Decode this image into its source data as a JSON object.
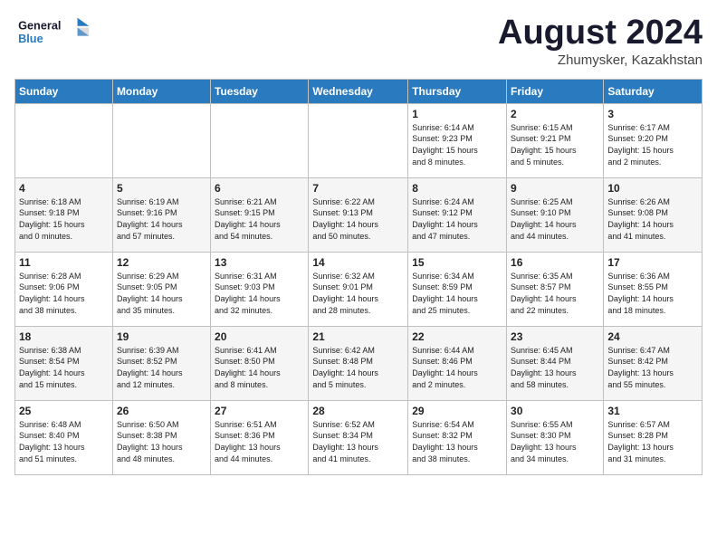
{
  "header": {
    "logo_general": "General",
    "logo_blue": "Blue",
    "month": "August 2024",
    "location": "Zhumysker, Kazakhstan"
  },
  "weekdays": [
    "Sunday",
    "Monday",
    "Tuesday",
    "Wednesday",
    "Thursday",
    "Friday",
    "Saturday"
  ],
  "weeks": [
    [
      {
        "day": "",
        "info": ""
      },
      {
        "day": "",
        "info": ""
      },
      {
        "day": "",
        "info": ""
      },
      {
        "day": "",
        "info": ""
      },
      {
        "day": "1",
        "info": "Sunrise: 6:14 AM\nSunset: 9:23 PM\nDaylight: 15 hours\nand 8 minutes."
      },
      {
        "day": "2",
        "info": "Sunrise: 6:15 AM\nSunset: 9:21 PM\nDaylight: 15 hours\nand 5 minutes."
      },
      {
        "day": "3",
        "info": "Sunrise: 6:17 AM\nSunset: 9:20 PM\nDaylight: 15 hours\nand 2 minutes."
      }
    ],
    [
      {
        "day": "4",
        "info": "Sunrise: 6:18 AM\nSunset: 9:18 PM\nDaylight: 15 hours\nand 0 minutes."
      },
      {
        "day": "5",
        "info": "Sunrise: 6:19 AM\nSunset: 9:16 PM\nDaylight: 14 hours\nand 57 minutes."
      },
      {
        "day": "6",
        "info": "Sunrise: 6:21 AM\nSunset: 9:15 PM\nDaylight: 14 hours\nand 54 minutes."
      },
      {
        "day": "7",
        "info": "Sunrise: 6:22 AM\nSunset: 9:13 PM\nDaylight: 14 hours\nand 50 minutes."
      },
      {
        "day": "8",
        "info": "Sunrise: 6:24 AM\nSunset: 9:12 PM\nDaylight: 14 hours\nand 47 minutes."
      },
      {
        "day": "9",
        "info": "Sunrise: 6:25 AM\nSunset: 9:10 PM\nDaylight: 14 hours\nand 44 minutes."
      },
      {
        "day": "10",
        "info": "Sunrise: 6:26 AM\nSunset: 9:08 PM\nDaylight: 14 hours\nand 41 minutes."
      }
    ],
    [
      {
        "day": "11",
        "info": "Sunrise: 6:28 AM\nSunset: 9:06 PM\nDaylight: 14 hours\nand 38 minutes."
      },
      {
        "day": "12",
        "info": "Sunrise: 6:29 AM\nSunset: 9:05 PM\nDaylight: 14 hours\nand 35 minutes."
      },
      {
        "day": "13",
        "info": "Sunrise: 6:31 AM\nSunset: 9:03 PM\nDaylight: 14 hours\nand 32 minutes."
      },
      {
        "day": "14",
        "info": "Sunrise: 6:32 AM\nSunset: 9:01 PM\nDaylight: 14 hours\nand 28 minutes."
      },
      {
        "day": "15",
        "info": "Sunrise: 6:34 AM\nSunset: 8:59 PM\nDaylight: 14 hours\nand 25 minutes."
      },
      {
        "day": "16",
        "info": "Sunrise: 6:35 AM\nSunset: 8:57 PM\nDaylight: 14 hours\nand 22 minutes."
      },
      {
        "day": "17",
        "info": "Sunrise: 6:36 AM\nSunset: 8:55 PM\nDaylight: 14 hours\nand 18 minutes."
      }
    ],
    [
      {
        "day": "18",
        "info": "Sunrise: 6:38 AM\nSunset: 8:54 PM\nDaylight: 14 hours\nand 15 minutes."
      },
      {
        "day": "19",
        "info": "Sunrise: 6:39 AM\nSunset: 8:52 PM\nDaylight: 14 hours\nand 12 minutes."
      },
      {
        "day": "20",
        "info": "Sunrise: 6:41 AM\nSunset: 8:50 PM\nDaylight: 14 hours\nand 8 minutes."
      },
      {
        "day": "21",
        "info": "Sunrise: 6:42 AM\nSunset: 8:48 PM\nDaylight: 14 hours\nand 5 minutes."
      },
      {
        "day": "22",
        "info": "Sunrise: 6:44 AM\nSunset: 8:46 PM\nDaylight: 14 hours\nand 2 minutes."
      },
      {
        "day": "23",
        "info": "Sunrise: 6:45 AM\nSunset: 8:44 PM\nDaylight: 13 hours\nand 58 minutes."
      },
      {
        "day": "24",
        "info": "Sunrise: 6:47 AM\nSunset: 8:42 PM\nDaylight: 13 hours\nand 55 minutes."
      }
    ],
    [
      {
        "day": "25",
        "info": "Sunrise: 6:48 AM\nSunset: 8:40 PM\nDaylight: 13 hours\nand 51 minutes."
      },
      {
        "day": "26",
        "info": "Sunrise: 6:50 AM\nSunset: 8:38 PM\nDaylight: 13 hours\nand 48 minutes."
      },
      {
        "day": "27",
        "info": "Sunrise: 6:51 AM\nSunset: 8:36 PM\nDaylight: 13 hours\nand 44 minutes."
      },
      {
        "day": "28",
        "info": "Sunrise: 6:52 AM\nSunset: 8:34 PM\nDaylight: 13 hours\nand 41 minutes."
      },
      {
        "day": "29",
        "info": "Sunrise: 6:54 AM\nSunset: 8:32 PM\nDaylight: 13 hours\nand 38 minutes."
      },
      {
        "day": "30",
        "info": "Sunrise: 6:55 AM\nSunset: 8:30 PM\nDaylight: 13 hours\nand 34 minutes."
      },
      {
        "day": "31",
        "info": "Sunrise: 6:57 AM\nSunset: 8:28 PM\nDaylight: 13 hours\nand 31 minutes."
      }
    ]
  ]
}
